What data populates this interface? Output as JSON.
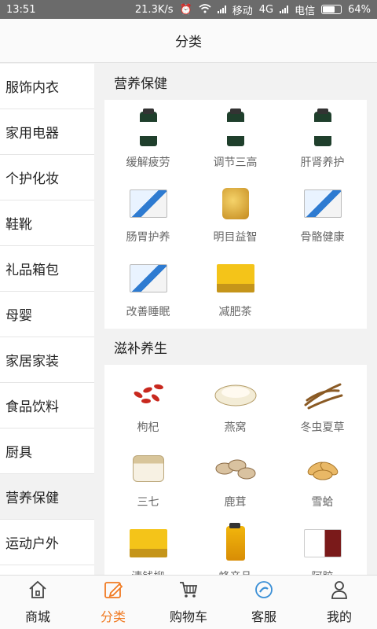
{
  "status": {
    "time": "13:51",
    "speed": "21.3K/s",
    "carrier1": "移动",
    "network": "4G",
    "carrier2": "电信",
    "battery": "64%"
  },
  "header": {
    "title": "分类"
  },
  "sidebar": {
    "items": [
      {
        "label": "服饰内衣"
      },
      {
        "label": "家用电器"
      },
      {
        "label": "个护化妆"
      },
      {
        "label": "鞋靴"
      },
      {
        "label": "礼品箱包"
      },
      {
        "label": "母婴"
      },
      {
        "label": "家居家装"
      },
      {
        "label": "食品饮料"
      },
      {
        "label": "厨具"
      },
      {
        "label": "营养保健"
      },
      {
        "label": "运动户外"
      }
    ],
    "active_label": "营养保健"
  },
  "sections": [
    {
      "title": "营养保健",
      "items": [
        {
          "label": "缓解疲劳",
          "icon": "supplement-bottle-icon"
        },
        {
          "label": "调节三高",
          "icon": "supplement-bottle-icon"
        },
        {
          "label": "肝肾养护",
          "icon": "supplement-bottle-icon"
        },
        {
          "label": "肠胃护养",
          "icon": "product-box-icon"
        },
        {
          "label": "明目益智",
          "icon": "capsule-jar-icon"
        },
        {
          "label": "骨骼健康",
          "icon": "product-box-icon"
        },
        {
          "label": "改善睡眠",
          "icon": "product-box-icon"
        },
        {
          "label": "减肥茶",
          "icon": "tea-box-icon"
        }
      ]
    },
    {
      "title": "滋补养生",
      "items": [
        {
          "label": "枸杞",
          "icon": "goji-berries-icon"
        },
        {
          "label": "燕窝",
          "icon": "birds-nest-icon"
        },
        {
          "label": "冬虫夏草",
          "icon": "cordyceps-icon"
        },
        {
          "label": "三七",
          "icon": "herb-jar-icon"
        },
        {
          "label": "鹿茸",
          "icon": "antler-slices-icon"
        },
        {
          "label": "雪蛤",
          "icon": "snow-frog-icon"
        },
        {
          "label": "清钱柳",
          "icon": "tea-box-icon"
        },
        {
          "label": "蜂产品",
          "icon": "honey-bottle-icon"
        },
        {
          "label": "阿胶",
          "icon": "gelatin-box-icon"
        }
      ]
    }
  ],
  "tabbar": {
    "items": [
      {
        "label": "商城",
        "icon": "home-icon"
      },
      {
        "label": "分类",
        "icon": "category-edit-icon"
      },
      {
        "label": "购物车",
        "icon": "cart-icon"
      },
      {
        "label": "客服",
        "icon": "customer-service-icon"
      },
      {
        "label": "我的",
        "icon": "user-icon"
      }
    ],
    "active_label": "分类"
  },
  "colors": {
    "accent": "#f07a22",
    "status_bar": "#6b6b6b",
    "page_bg": "#f2f2f2"
  }
}
